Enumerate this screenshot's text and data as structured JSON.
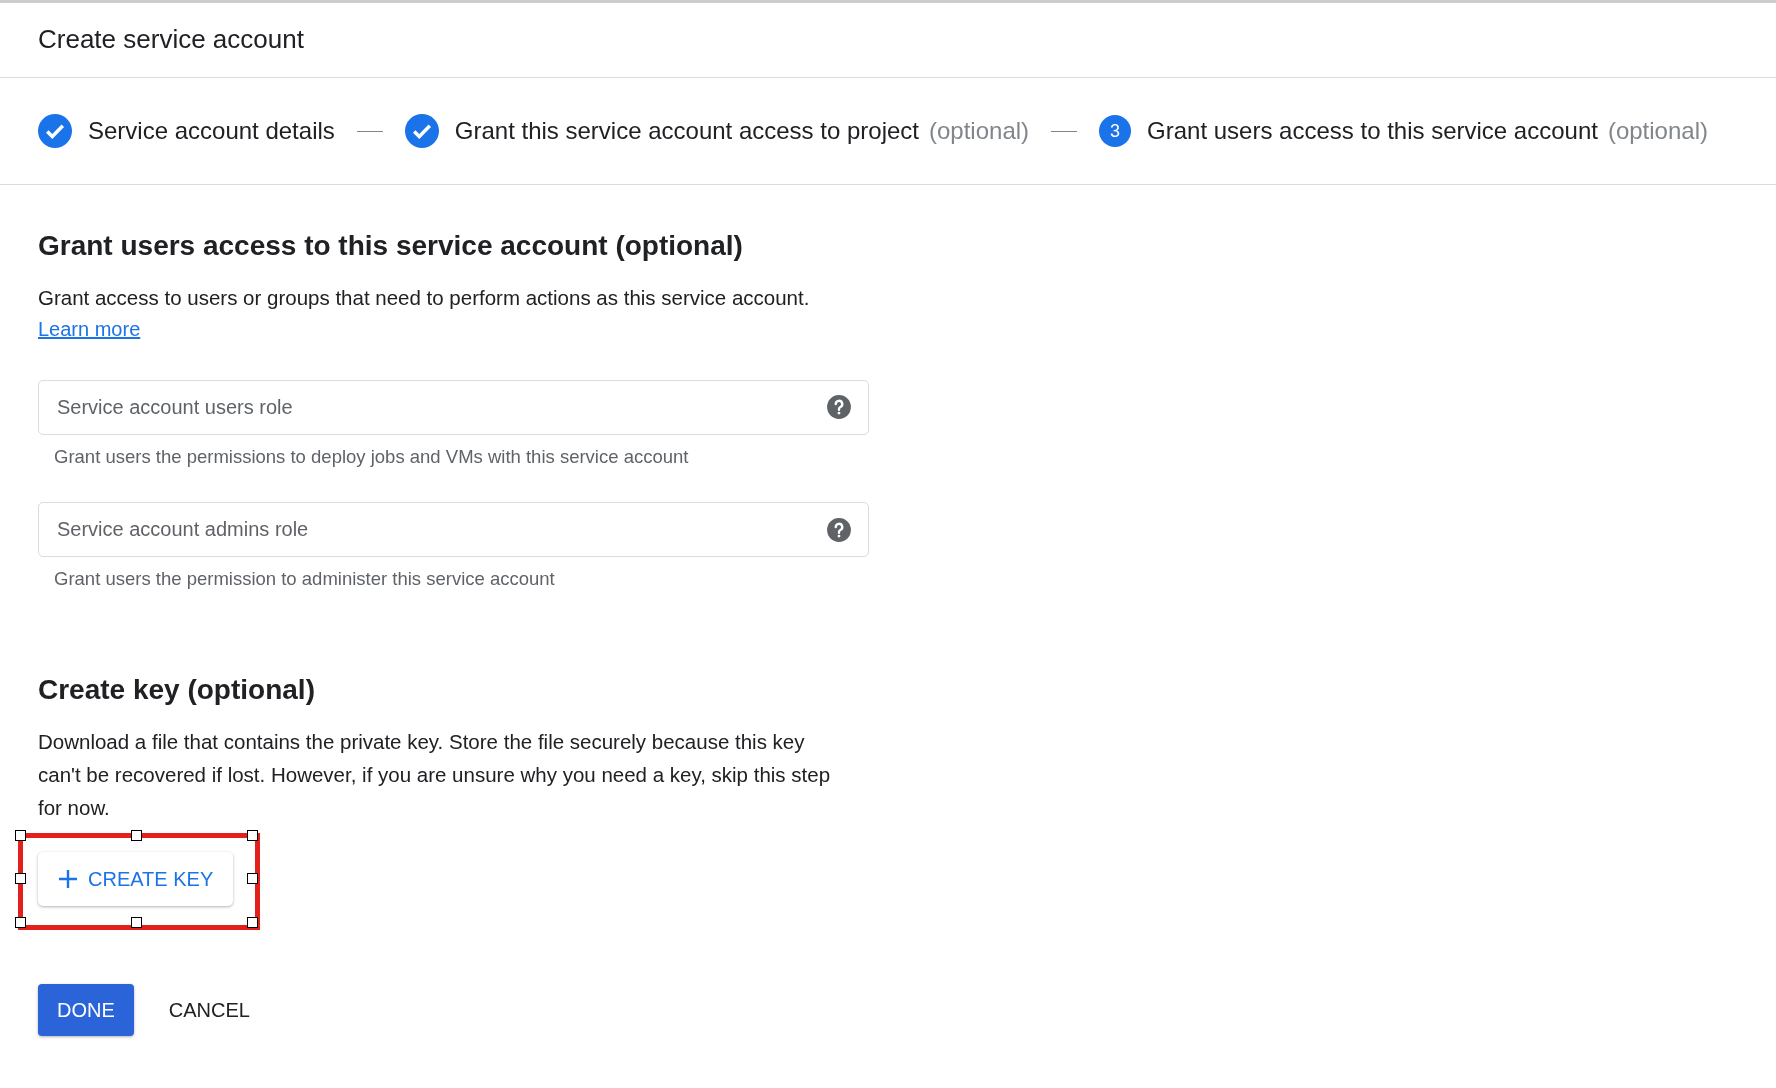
{
  "window": {
    "title": "Create service account"
  },
  "steps": [
    {
      "label": "Service account details",
      "completed": true
    },
    {
      "label": "Grant this service account access to project",
      "note": "(optional)",
      "completed": true
    },
    {
      "label": "Grant users access to this service account",
      "note": "(optional)",
      "completed": false,
      "number": "3"
    }
  ],
  "grant_section": {
    "heading": "Grant users access to this service account (optional)",
    "description": "Grant access to users or groups that need to perform actions as this service account.",
    "link": "Learn more",
    "fields": [
      {
        "placeholder": "Service account users role",
        "helper": "Grant users the permissions to deploy jobs and VMs with this service account"
      },
      {
        "placeholder": "Service account admins role",
        "helper": "Grant users the permission to administer this service account"
      }
    ]
  },
  "key_section": {
    "heading": "Create key (optional)",
    "description": "Download a file that contains the private key. Store the file securely because this key can't be recovered if lost. However, if you are unsure why you need a key, skip this step for now.",
    "button": {
      "label": "CREATE KEY",
      "highlighted": true
    }
  },
  "actions": [
    {
      "label": "DONE",
      "kind": "primary"
    },
    {
      "label": "CANCEL",
      "kind": "text"
    }
  ]
}
